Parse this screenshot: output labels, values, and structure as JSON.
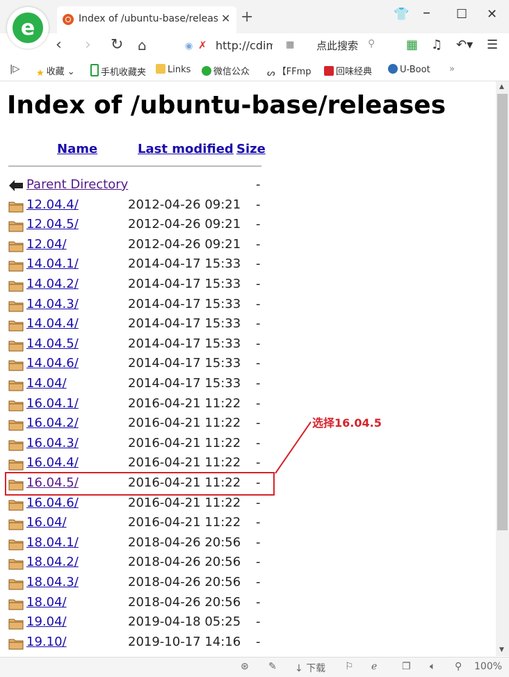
{
  "browser": {
    "tab_title": "Index of /ubuntu-base/releases",
    "url_text": "http://cdim",
    "search_placeholder": "点此搜索",
    "zoom": "100%",
    "download_label": "下载"
  },
  "bookmarks": [
    {
      "label": "收藏",
      "icon": "star-icon"
    },
    {
      "label": "手机收藏夹",
      "icon": "phone-icon"
    },
    {
      "label": "Links",
      "icon": "folder-icon"
    },
    {
      "label": "微信公众",
      "icon": "wechat-icon"
    },
    {
      "label": "【FFmp",
      "icon": "app-icon"
    },
    {
      "label": "回味经典",
      "icon": "app-icon"
    },
    {
      "label": "U-Boot",
      "icon": "uboot-icon"
    }
  ],
  "page": {
    "heading": "Index of /ubuntu-base/releases",
    "columns": {
      "name": "Name",
      "modified": "Last modified",
      "size": "Size"
    },
    "parent": {
      "label": "Parent Directory",
      "size": "-"
    },
    "rows": [
      {
        "name": "12.04.4/",
        "date": "2012-04-26 09:21",
        "size": "-"
      },
      {
        "name": "12.04.5/",
        "date": "2012-04-26 09:21",
        "size": "-"
      },
      {
        "name": "12.04/",
        "date": "2012-04-26 09:21",
        "size": "-"
      },
      {
        "name": "14.04.1/",
        "date": "2014-04-17 15:33",
        "size": "-"
      },
      {
        "name": "14.04.2/",
        "date": "2014-04-17 15:33",
        "size": "-"
      },
      {
        "name": "14.04.3/",
        "date": "2014-04-17 15:33",
        "size": "-"
      },
      {
        "name": "14.04.4/",
        "date": "2014-04-17 15:33",
        "size": "-"
      },
      {
        "name": "14.04.5/",
        "date": "2014-04-17 15:33",
        "size": "-"
      },
      {
        "name": "14.04.6/",
        "date": "2014-04-17 15:33",
        "size": "-"
      },
      {
        "name": "14.04/",
        "date": "2014-04-17 15:33",
        "size": "-"
      },
      {
        "name": "16.04.1/",
        "date": "2016-04-21 11:22",
        "size": "-"
      },
      {
        "name": "16.04.2/",
        "date": "2016-04-21 11:22",
        "size": "-"
      },
      {
        "name": "16.04.3/",
        "date": "2016-04-21 11:22",
        "size": "-"
      },
      {
        "name": "16.04.4/",
        "date": "2016-04-21 11:22",
        "size": "-"
      },
      {
        "name": "16.04.5/",
        "date": "2016-04-21 11:22",
        "size": "-"
      },
      {
        "name": "16.04.6/",
        "date": "2016-04-21 11:22",
        "size": "-"
      },
      {
        "name": "16.04/",
        "date": "2016-04-21 11:22",
        "size": "-"
      },
      {
        "name": "18.04.1/",
        "date": "2018-04-26 20:56",
        "size": "-"
      },
      {
        "name": "18.04.2/",
        "date": "2018-04-26 20:56",
        "size": "-"
      },
      {
        "name": "18.04.3/",
        "date": "2018-04-26 20:56",
        "size": "-"
      },
      {
        "name": "18.04/",
        "date": "2018-04-26 20:56",
        "size": "-"
      },
      {
        "name": "19.04/",
        "date": "2019-04-18 05:25",
        "size": "-"
      },
      {
        "name": "19.10/",
        "date": "2019-10-17 14:16",
        "size": "-"
      }
    ]
  },
  "annotation": {
    "text": "选择16.04.5",
    "color": "#d6232a"
  },
  "colors": {
    "link": "#1a0dab",
    "folder": "#e7b36b",
    "highlight": "#d6232a"
  }
}
